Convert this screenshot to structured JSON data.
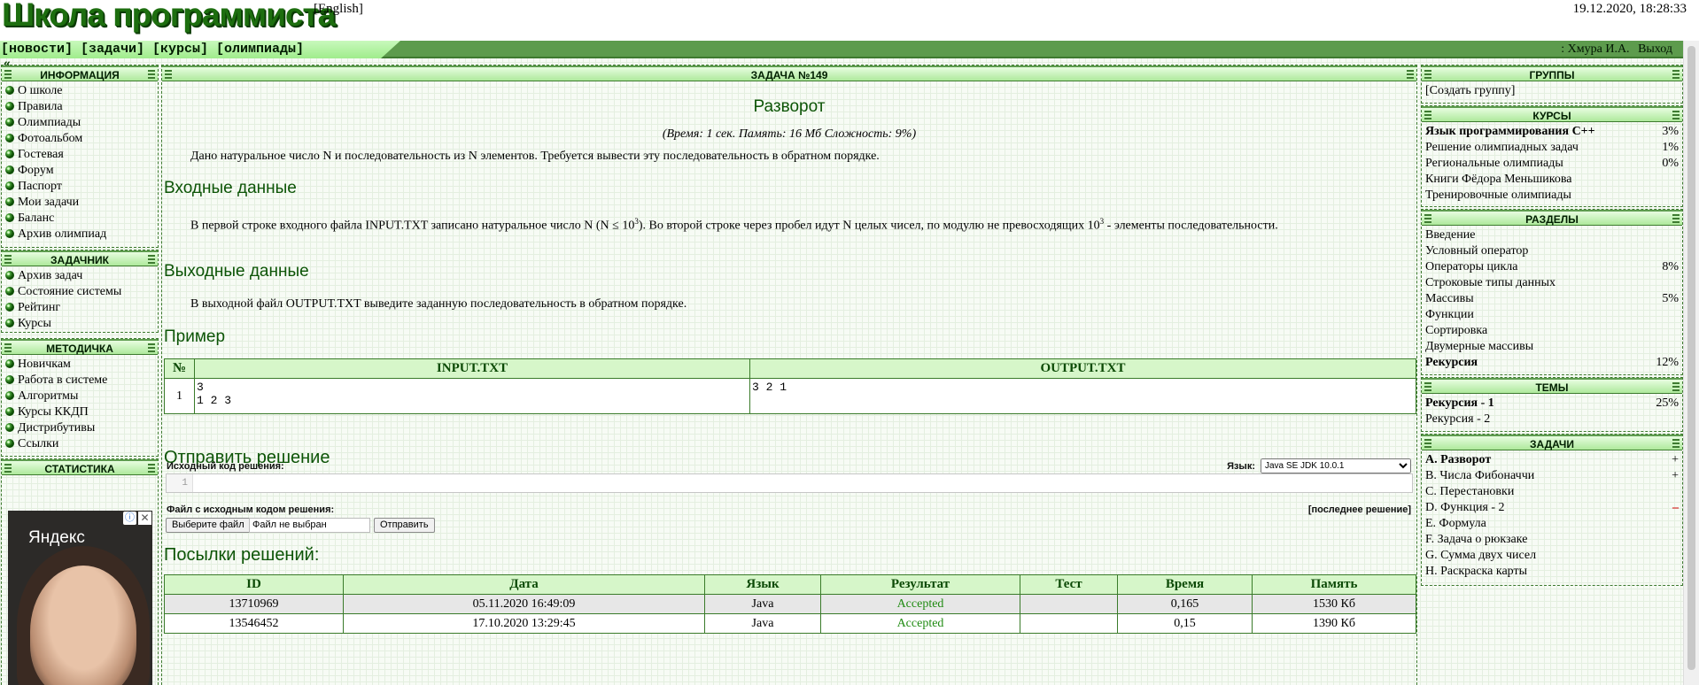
{
  "site": {
    "logo": "Школа программиста",
    "lang_link": "[English]",
    "datetime": "19.12.2020, 18:28:33"
  },
  "menu": {
    "items": [
      "[новости]",
      "[задачи]",
      "[курсы]",
      "[олимпиады]"
    ],
    "user": ": Хмура И.А.",
    "logout": "Выход",
    "collapse": "«"
  },
  "left": {
    "info": {
      "title": "ИНФОРМАЦИЯ",
      "items": [
        "О школе",
        "Правила",
        "Олимпиады",
        "Фотоальбом",
        "Гостевая",
        "Форум",
        "Паспорт",
        "Мои задачи",
        "Баланс",
        "Архив олимпиад"
      ]
    },
    "tasks": {
      "title": "ЗАДАЧНИК",
      "items": [
        "Архив задач",
        "Состояние системы",
        "Рейтинг",
        "Курсы"
      ]
    },
    "method": {
      "title": "МЕТОДИЧКА",
      "items": [
        "Новичкам",
        "Работа в системе",
        "Алгоритмы",
        "Курсы ККДП",
        "Дистрибутивы",
        "Ссылки"
      ]
    },
    "stats": {
      "title": "СТАТИСТИКА"
    },
    "ad": {
      "brand": "Яндекс",
      "info": "ⓘ",
      "close": "✕"
    }
  },
  "main": {
    "header": "ЗАДАЧА №149",
    "title": "Разворот",
    "limits": "(Время: 1 сек. Память: 16 Мб Сложность: 9%)",
    "statement": "Дано натуральное число N и последовательность из N элементов. Требуется вывести эту последовательность в обратном порядке.",
    "input_h": "Входные данные",
    "input_p1": "В первой строке входного файла INPUT.TXT записано натуральное число N (N ≤ 10",
    "input_p2": "). Во второй строке через пробел идут N целых чисел, по модулю не превосходящих 10",
    "input_p3": " - элементы последовательности.",
    "input_exp": "3",
    "output_h": "Выходные данные",
    "output_p": "В выходной файл OUTPUT.TXT выведите заданную последовательность в обратном порядке.",
    "example_h": "Пример",
    "example": {
      "cols": [
        "№",
        "INPUT.TXT",
        "OUTPUT.TXT"
      ],
      "num": "1",
      "input": "3\n1 2 3",
      "output": "3 2 1"
    },
    "submit_h": "Отправить решение",
    "src_label": "Исходный код решения:",
    "lang_label": "Язык:",
    "lang_value": "Java SE JDK 10.0.1",
    "line_no": "1",
    "file_label": "Файл с исходным кодом решения:",
    "last_link": "[последнее решение]",
    "choose_btn": "Выберите файл",
    "no_file": "Файл не выбран",
    "send_btn": "Отправить",
    "subs_h": "Посылки решений:",
    "subs": {
      "cols": [
        "ID",
        "Дата",
        "Язык",
        "Результат",
        "Тест",
        "Время",
        "Память"
      ],
      "rows": [
        [
          "13710969",
          "05.11.2020 16:49:09",
          "Java",
          "Accepted",
          "",
          "0,165",
          "1530 Кб"
        ],
        [
          "13546452",
          "17.10.2020 13:29:45",
          "Java",
          "Accepted",
          "",
          "0,15",
          "1390 Кб"
        ]
      ]
    }
  },
  "right": {
    "groups": {
      "title": "ГРУППЫ",
      "create": "[Создать группу]"
    },
    "courses": {
      "title": "КУРСЫ",
      "items": [
        {
          "name": "Язык программирования C++",
          "val": "3%",
          "bold": true
        },
        {
          "name": "Решение олимпиадных задач",
          "val": "1%"
        },
        {
          "name": "Региональные олимпиады",
          "val": "0%"
        },
        {
          "name": "Книги Фёдора Меньшикова",
          "val": ""
        },
        {
          "name": "Тренировочные олимпиады",
          "val": ""
        }
      ]
    },
    "sections": {
      "title": "РАЗДЕЛЫ",
      "items": [
        {
          "name": "Введение",
          "val": ""
        },
        {
          "name": "Условный оператор",
          "val": ""
        },
        {
          "name": "Операторы цикла",
          "val": "8%"
        },
        {
          "name": "Строковые типы данных",
          "val": ""
        },
        {
          "name": "Массивы",
          "val": "5%"
        },
        {
          "name": "Функции",
          "val": ""
        },
        {
          "name": "Сортировка",
          "val": ""
        },
        {
          "name": "Двумерные массивы",
          "val": ""
        },
        {
          "name": "Рекурсия",
          "val": "12%",
          "bold": true
        }
      ]
    },
    "topics": {
      "title": "ТЕМЫ",
      "items": [
        {
          "name": "Рекурсия - 1",
          "val": "25%",
          "bold": true
        },
        {
          "name": "Рекурсия - 2",
          "val": ""
        }
      ]
    },
    "problems": {
      "title": "ЗАДАЧИ",
      "items": [
        {
          "name": "A. Разворот",
          "val": "+",
          "bold": true
        },
        {
          "name": "B. Числа Фибоначчи",
          "val": "+"
        },
        {
          "name": "C. Перестановки",
          "val": ""
        },
        {
          "name": "D. Функция - 2",
          "val": "–",
          "minus": true
        },
        {
          "name": "E. Формула",
          "val": ""
        },
        {
          "name": "F. Задача о рюкзаке",
          "val": ""
        },
        {
          "name": "G. Сумма двух чисел",
          "val": ""
        },
        {
          "name": "H. Раскраска карты",
          "val": ""
        }
      ]
    }
  }
}
